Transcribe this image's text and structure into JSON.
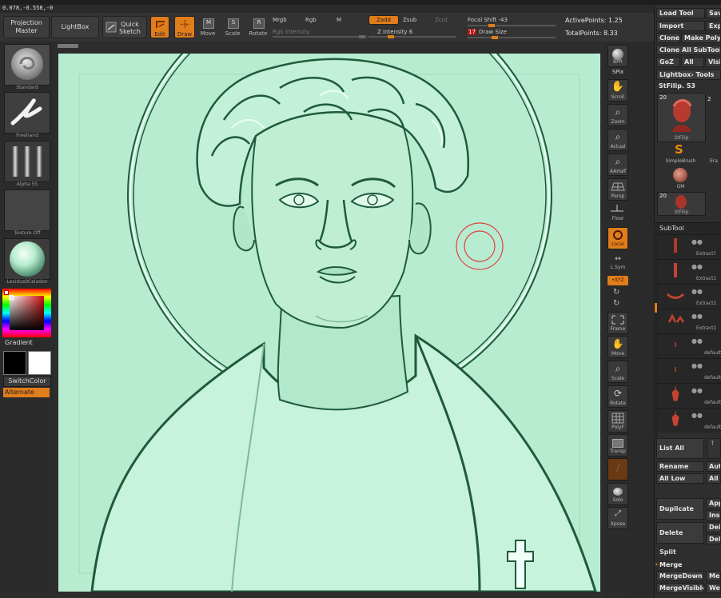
{
  "top": {
    "coords": "0.078,-0.558,-0",
    "projection_master": "Projection\nMaster",
    "lightbox": "LightBox",
    "quick_sketch": "Quick\nSketch",
    "edit": "Edit",
    "draw": "Draw",
    "move": "Move",
    "scale": "Scale",
    "rotate": "Rotate",
    "mrgb": "Mrgb",
    "rgb": "Rgb",
    "m": "M",
    "rgb_intensity": "Rgb Intensity",
    "zadd": "Zadd",
    "zsub": "Zsub",
    "zcut": "Zcut",
    "z_intensity": "Z Intensity 6",
    "focal_shift": "Focal Shift -43",
    "draw_size_value": "17",
    "draw_size": "Draw Size",
    "active_points": "ActivePoints: 1.25",
    "total_points": "TotalPoints: 8.33"
  },
  "left": {
    "standard": "Standard",
    "freehand": "Freehand",
    "alpha": "Alpha 55",
    "texture": "Texture Off",
    "material": "Lexidus9Celadon",
    "gradient": "Gradient",
    "switchcolor": "SwitchColor",
    "alternate": "Alternate"
  },
  "rtools": {
    "bpr": "BPR",
    "spix": "SPix",
    "scroll": "Scroll",
    "zoom": "Zoom",
    "actual": "Actual",
    "aahalf": "AAHalf",
    "persp": "Persp",
    "floor": "Floor",
    "local": "Local",
    "lsym": "L.Sym",
    "xyz": "•XYZ",
    "frame": "Frame",
    "move": "Move",
    "scale": "Scale",
    "rotate": "Rotate",
    "polyf": "PolyF",
    "transp": "Transp",
    "solo": "Solo",
    "xpose": "Xpose"
  },
  "panel": {
    "load_tool": "Load Tool",
    "save": "Save",
    "import": "Import",
    "export": "Exp",
    "clone": "Clone",
    "make_polymesh": "Make PolyM",
    "clone_all": "Clone All SubTools",
    "goz": "GoZ",
    "all": "All",
    "visible": "Visib",
    "lightbox_tools": "Lightbox› Tools",
    "current_tool": "StFilip. 53",
    "tool_count": "20",
    "tool_count2": "2",
    "thumb1": "StFilip",
    "simplebrush": "SimpleBrush",
    "era": "Era",
    "gm": "GM",
    "thumb4": "StFilip",
    "subtool": "SubTool",
    "st_names": [
      "Extract?",
      "Extract1",
      "Extract1",
      "Extract1",
      "default",
      "default",
      "default",
      "default"
    ],
    "list_all": "List All",
    "rename": "Rename",
    "auto": "Auto",
    "all_low": "All Low",
    "all_high": "All H",
    "duplicate": "Duplicate",
    "append": "App",
    "insert": "Inse",
    "delete": "Delete",
    "del_other": "Del",
    "del_all": "Del",
    "split": "Split",
    "merge": "Merge",
    "merge_down": "MergeDown",
    "merge_similar": "Mer",
    "merge_visible": "MergeVisible",
    "weld": "Wel"
  },
  "colors": {
    "accent": "#e07d1c",
    "canvas": "#b7ecd1",
    "relief_dark": "#1f5a3c",
    "brush_cursor": "#e04040"
  }
}
